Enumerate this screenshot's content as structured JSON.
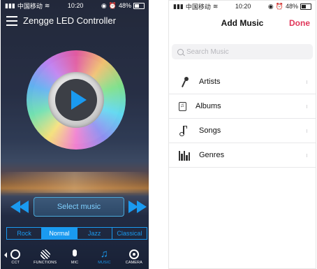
{
  "left_phone": {
    "status": {
      "carrier": "中国移动",
      "time": "10:20",
      "battery": "48%"
    },
    "header": {
      "title": "Zengge LED Controller"
    },
    "select_music_label": "Select music",
    "genre_tabs": [
      {
        "label": "Rock",
        "active": false
      },
      {
        "label": "Normal",
        "active": true
      },
      {
        "label": "Jazz",
        "active": false
      },
      {
        "label": "Classical",
        "active": false
      }
    ],
    "bottom_nav": [
      {
        "label": "CCT",
        "icon": "cct-icon"
      },
      {
        "label": "FUNCTIONS",
        "icon": "functions-icon"
      },
      {
        "label": "MIC",
        "icon": "mic-icon"
      },
      {
        "label": "MUSIC",
        "icon": "music-icon",
        "active": true
      },
      {
        "label": "CAMERA",
        "icon": "camera-icon"
      }
    ],
    "colors": {
      "accent": "#1a9af0"
    }
  },
  "right_phone": {
    "status": {
      "carrier": "中国移动",
      "time": "10:20",
      "battery": "48%"
    },
    "nav": {
      "title": "Add Music",
      "done": "Done"
    },
    "search": {
      "placeholder": "Search Music"
    },
    "list": [
      {
        "label": "Artists",
        "icon": "microphone-icon"
      },
      {
        "label": "Albums",
        "icon": "album-icon"
      },
      {
        "label": "Songs",
        "icon": "music-note-icon"
      },
      {
        "label": "Genres",
        "icon": "genres-icon"
      }
    ],
    "colors": {
      "done": "#e0375a"
    }
  }
}
